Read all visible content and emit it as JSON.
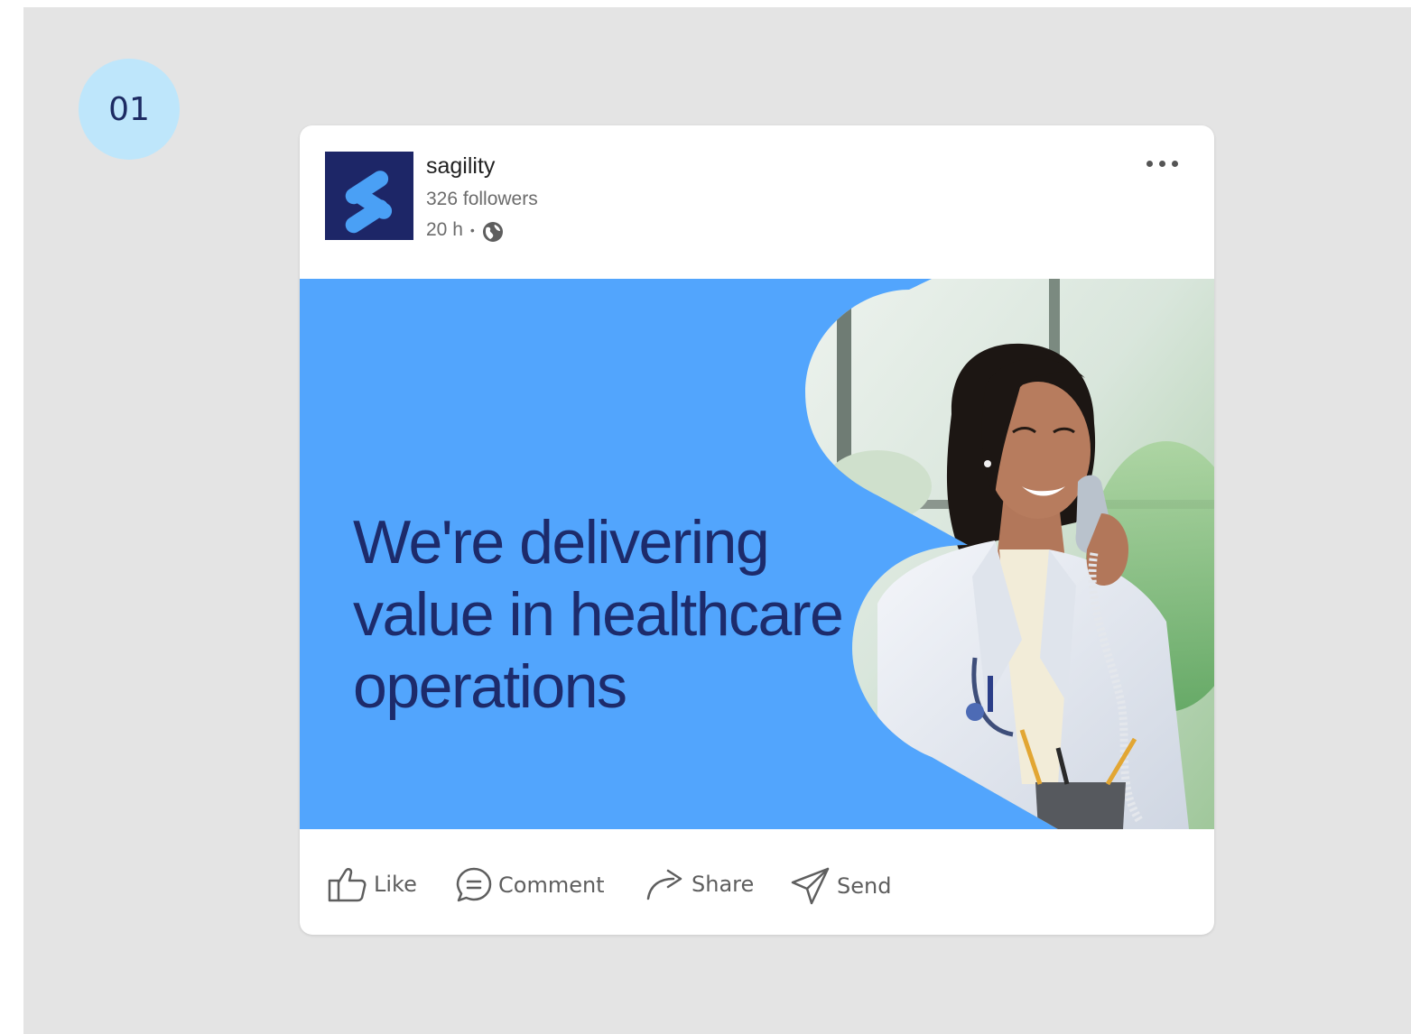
{
  "step": {
    "number": "01"
  },
  "post": {
    "company_name": "sagility",
    "followers": "326 followers",
    "time": "20 h",
    "dot": "•",
    "headline": "We're delivering value in healthcare operations"
  },
  "actions": [
    {
      "label": "Like",
      "icon": "thumbs-up-icon"
    },
    {
      "label": "Comment",
      "icon": "comment-icon"
    },
    {
      "label": "Share",
      "icon": "share-arrow-icon"
    },
    {
      "label": "Send",
      "icon": "send-plane-icon"
    }
  ],
  "colors": {
    "page_background": "#e4e4e4",
    "badge": "#bee6fb",
    "banner": "#52a5fd",
    "headline": "#1d2b6b",
    "logo_background": "#1d2667",
    "logo_mark": "#4aa0f5"
  }
}
